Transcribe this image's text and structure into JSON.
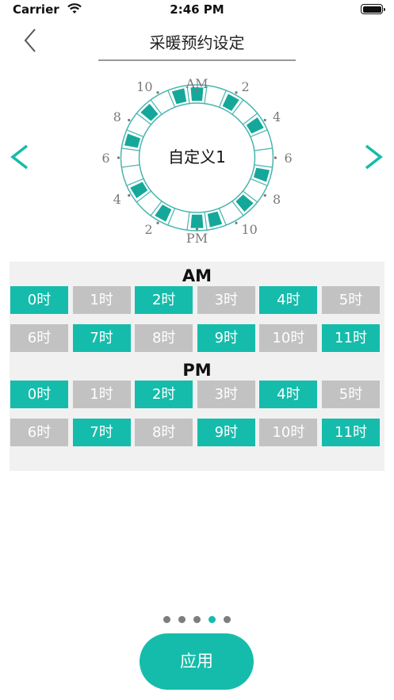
{
  "status_bar": {
    "carrier": "Carrier",
    "time": "2:46 PM"
  },
  "header": {
    "title": "采暖预约设定",
    "back_icon": "chevron-left-icon"
  },
  "dial": {
    "center_label": "自定义1",
    "am_label": "AM",
    "pm_label": "PM",
    "right_labels": [
      "2",
      "4",
      "6",
      "8",
      "10"
    ],
    "left_labels": [
      "10",
      "8",
      "6",
      "4",
      "2"
    ]
  },
  "navigation": {
    "prev_icon": "chevron-left-icon",
    "next_icon": "chevron-right-icon"
  },
  "schedule": {
    "am": {
      "label": "AM",
      "hours": [
        {
          "label": "0时",
          "on": true
        },
        {
          "label": "1时",
          "on": false
        },
        {
          "label": "2时",
          "on": true
        },
        {
          "label": "3时",
          "on": false
        },
        {
          "label": "4时",
          "on": true
        },
        {
          "label": "5时",
          "on": false
        },
        {
          "label": "6时",
          "on": false
        },
        {
          "label": "7时",
          "on": true
        },
        {
          "label": "8时",
          "on": false
        },
        {
          "label": "9时",
          "on": true
        },
        {
          "label": "10时",
          "on": false
        },
        {
          "label": "11时",
          "on": true
        }
      ]
    },
    "pm": {
      "label": "PM",
      "hours": [
        {
          "label": "0时",
          "on": true
        },
        {
          "label": "1时",
          "on": false
        },
        {
          "label": "2时",
          "on": true
        },
        {
          "label": "3时",
          "on": false
        },
        {
          "label": "4时",
          "on": true
        },
        {
          "label": "5时",
          "on": false
        },
        {
          "label": "6时",
          "on": false
        },
        {
          "label": "7时",
          "on": true
        },
        {
          "label": "8时",
          "on": false
        },
        {
          "label": "9时",
          "on": true
        },
        {
          "label": "10时",
          "on": false
        },
        {
          "label": "11时",
          "on": true
        }
      ]
    }
  },
  "pager": {
    "count": 5,
    "active_index": 3
  },
  "apply_button": {
    "label": "应用"
  },
  "colors": {
    "accent": "#15bcab",
    "inactive": "#c2c2c2",
    "panel": "#f1f1f1"
  }
}
